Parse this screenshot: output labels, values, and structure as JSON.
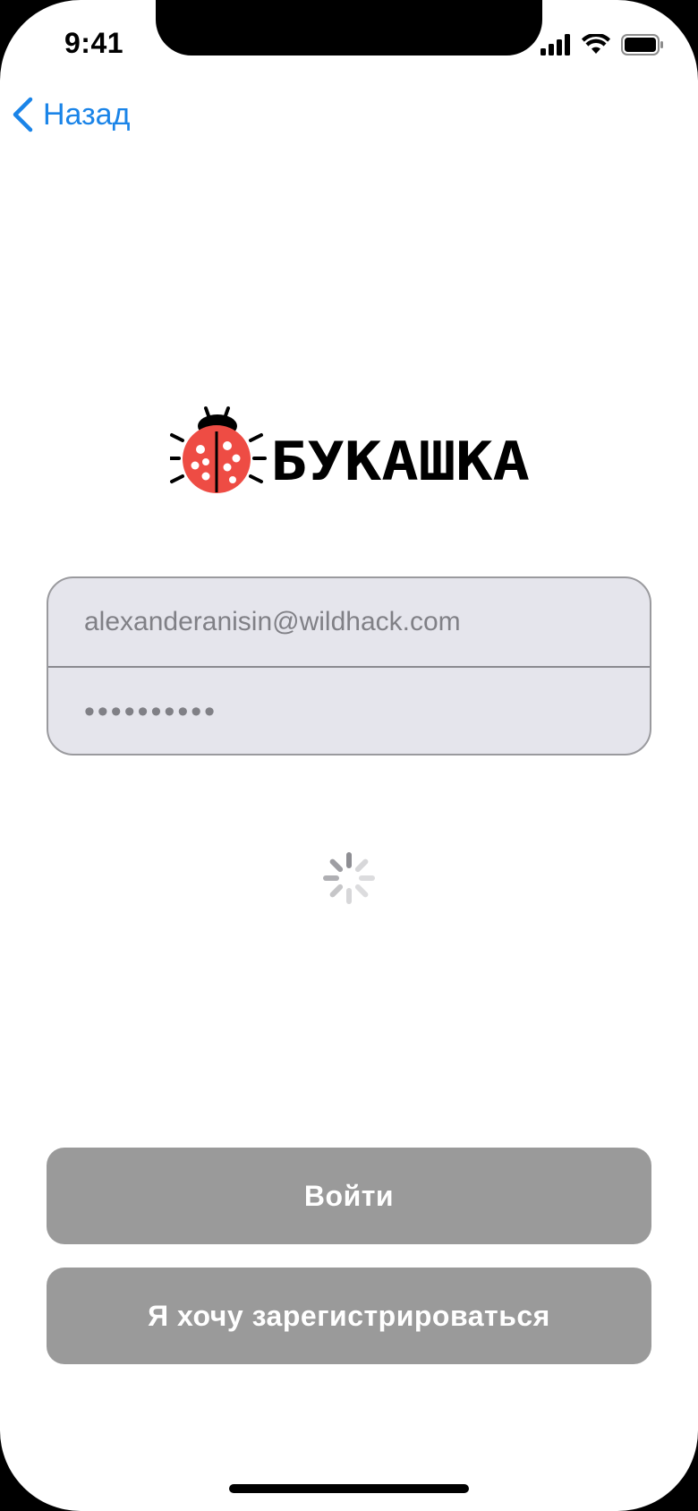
{
  "status_bar": {
    "time": "9:41"
  },
  "nav": {
    "back_label": "Назад",
    "accent_color": "#1a84e8"
  },
  "brand": {
    "logo_icon": "ladybug-icon",
    "logo_text": "БУКАШКА"
  },
  "login_form": {
    "email_value": "alexanderanisin@wildhack.com",
    "password_value": "••••••••••"
  },
  "loading": {
    "spinner_icon": "activity-indicator-icon"
  },
  "actions": {
    "login_label": "Войти",
    "register_label": "Я хочу зарегистрироваться",
    "button_color": "#9a9a9a"
  }
}
